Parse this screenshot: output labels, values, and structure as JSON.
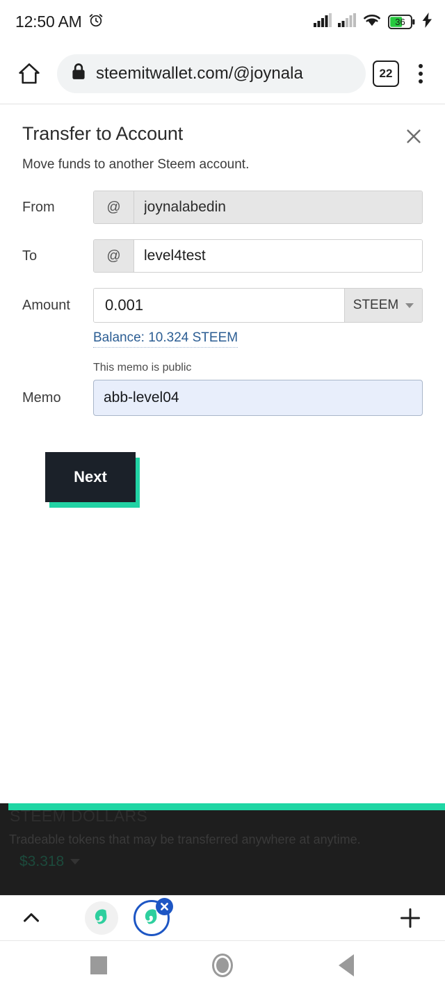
{
  "status_bar": {
    "time": "12:50 AM",
    "alarm_icon": "alarm-clock-icon",
    "signal_icon_1": "cellular-signal-icon",
    "signal_icon_2": "cellular-signal-icon",
    "wifi_icon": "wifi-icon",
    "battery_level": "36",
    "charging_icon": "charging-bolt-icon",
    "battery_color": "#27c93f"
  },
  "browser": {
    "home_icon": "home-icon",
    "lock_icon": "lock-icon",
    "url": "steemitwallet.com/@joynala",
    "tab_count": "22",
    "menu_icon": "kebab-menu-icon"
  },
  "modal": {
    "title": "Transfer to Account",
    "subtitle": "Move funds to another Steem account.",
    "close_icon": "close-icon",
    "fields": {
      "from": {
        "label": "From",
        "addon": "@",
        "value": "joynalabedin",
        "disabled": true
      },
      "to": {
        "label": "To",
        "addon": "@",
        "value": "level4test",
        "disabled": false
      },
      "amount": {
        "label": "Amount",
        "value": "0.001",
        "asset": "STEEM",
        "asset_caret": "chevron-down-icon"
      },
      "balance": {
        "text": "Balance: 10.324 STEEM",
        "color": "#2b5d93"
      },
      "memo": {
        "label": "Memo",
        "hint": "This memo is public",
        "value": "abb-level04"
      }
    },
    "submit_label": "Next",
    "submit_face_color": "#1b2129",
    "submit_shadow_color": "#22d3a4"
  },
  "background_card": {
    "title": "STEEM DOLLARS",
    "description": "Tradeable tokens that may be transferred anywhere at anytime.",
    "amount": "$3.318",
    "caret_icon": "chevron-down-icon",
    "accent_color": "#1fd6a4"
  },
  "tab_strip": {
    "expand_icon": "chevron-up-icon",
    "tabs": [
      {
        "favicon": "steem-logo-icon",
        "active": false,
        "name": "browser-tab-1"
      },
      {
        "favicon": "steem-logo-icon",
        "active": true,
        "name": "browser-tab-2",
        "close_icon": "close-circle-icon"
      }
    ],
    "new_tab_icon": "plus-icon"
  },
  "nav_bar": {
    "recents_icon": "square-recents-icon",
    "home_icon": "circle-home-icon",
    "back_icon": "triangle-back-icon"
  }
}
